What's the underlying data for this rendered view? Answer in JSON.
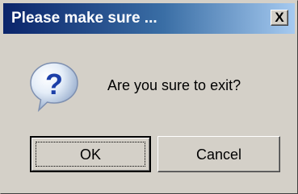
{
  "dialog": {
    "title": "Please make sure ...",
    "close_glyph": "X",
    "icon": "question-icon",
    "message": "Are you sure to exit?",
    "ok_label": "OK",
    "cancel_label": "Cancel"
  },
  "colors": {
    "titlebar_start": "#0a246a",
    "titlebar_end": "#a6caf0",
    "face": "#d4d0c8",
    "icon_blue": "#1c3fa8"
  }
}
